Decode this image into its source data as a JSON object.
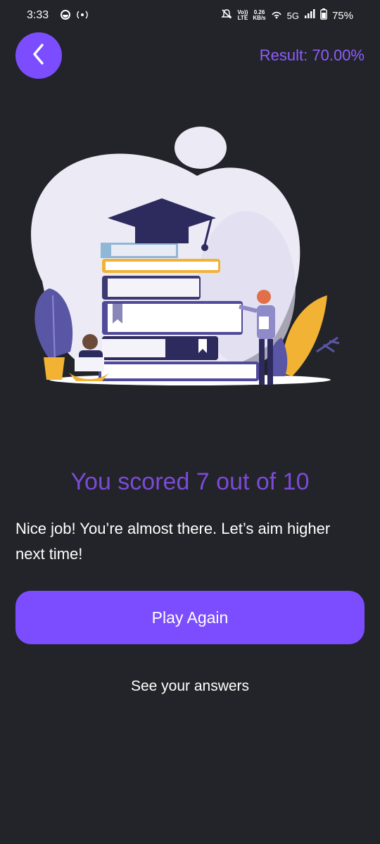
{
  "status_bar": {
    "time": "3:33",
    "network_speed_value": "0.26",
    "network_speed_unit": "KB/s",
    "volte_top": "Vo))",
    "volte_bottom": "LTE",
    "network_type": "5G",
    "battery": "75%"
  },
  "header": {
    "back_icon": "chevron-left-icon",
    "result_label": "Result: 70.00%"
  },
  "illustration": {
    "description_icon": "graduation-books-illustration"
  },
  "score": {
    "title": "You scored 7 out of 10",
    "message": "Nice job! You’re almost there. Let’s aim higher next time!"
  },
  "actions": {
    "play_again_label": "Play Again",
    "see_answers_label": "See your answers"
  },
  "colors": {
    "background": "#222429",
    "accent": "#7b4dff",
    "result_text": "#8f5cff",
    "score_text": "#7c4ad8"
  }
}
